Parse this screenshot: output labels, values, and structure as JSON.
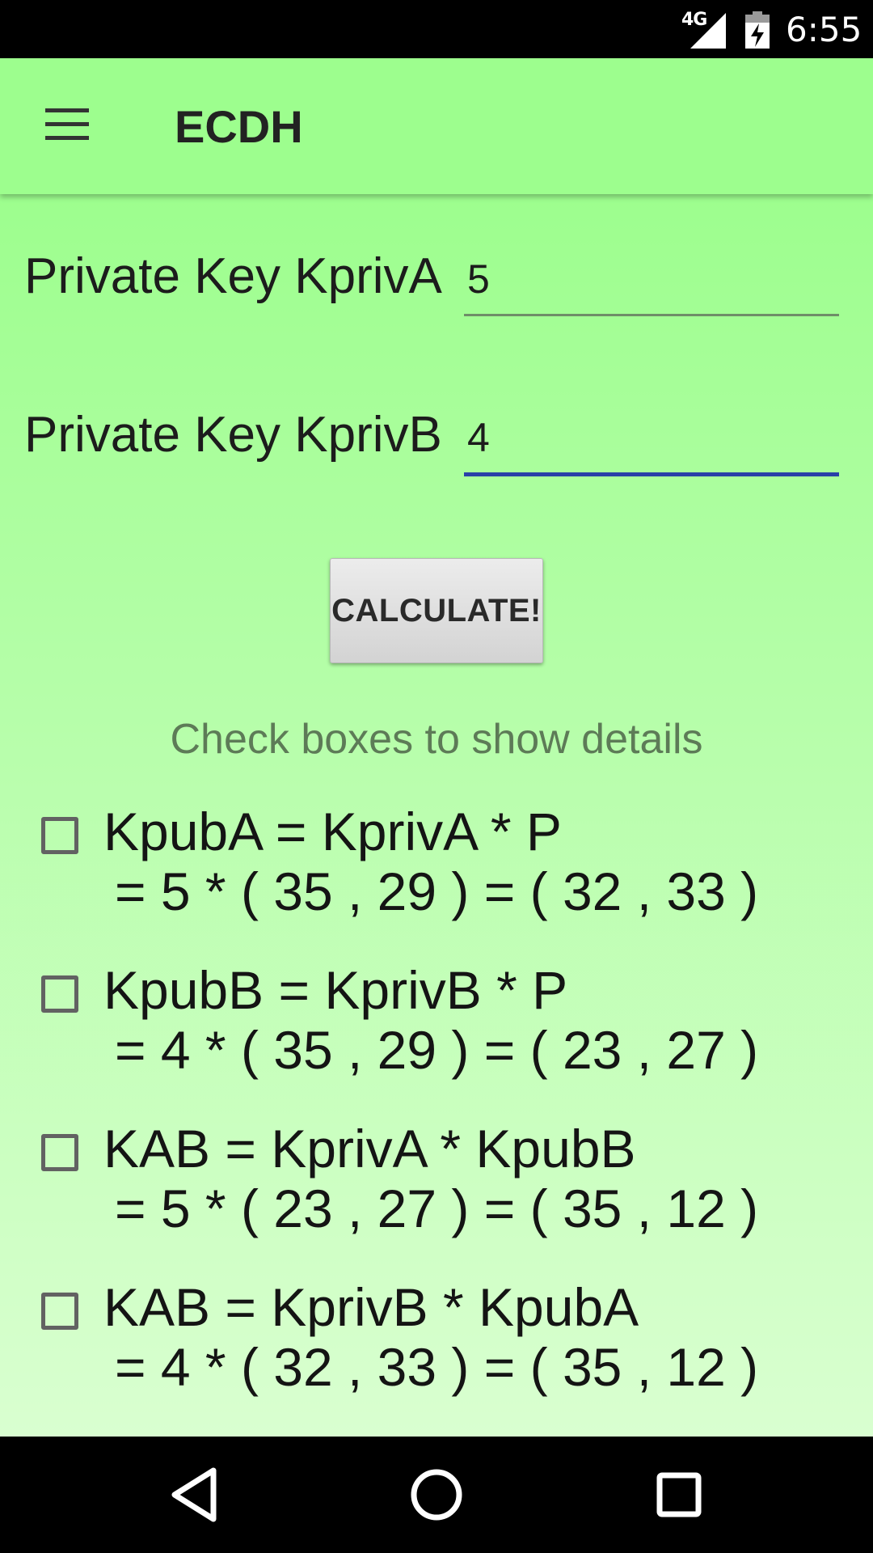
{
  "status_bar": {
    "network": "4G",
    "time": "6:55",
    "icons": [
      "signal-icon",
      "battery-charging-icon"
    ]
  },
  "app_bar": {
    "title": "ECDH",
    "menu_icon": "hamburger-menu-icon"
  },
  "form": {
    "kpriv_a": {
      "label": "Private Key KprivA",
      "value": "5"
    },
    "kpriv_b": {
      "label": "Private Key KprivB",
      "value": "4"
    },
    "calculate_label": "CALCULATE!"
  },
  "hint": "Check boxes to show details",
  "details": [
    {
      "line1": "KpubA = KprivA * P",
      "line2": "= 5 * ( 35 , 29 ) = ( 32 , 33 )",
      "checked": false
    },
    {
      "line1": "KpubB = KprivB * P",
      "line2": "= 4 * ( 35 , 29 ) = ( 23 , 27 )",
      "checked": false
    },
    {
      "line1": "KAB = KprivA * KpubB",
      "line2": "= 5 * ( 23 , 27 ) = ( 35 , 12 )",
      "checked": false
    },
    {
      "line1": "KAB = KprivB * KpubA",
      "line2": "= 4 * ( 32 , 33 ) = ( 35 , 12 )",
      "checked": false
    }
  ],
  "nav_bar": {
    "icons": [
      "back-icon",
      "home-icon",
      "recents-icon"
    ]
  },
  "colors": {
    "app_bar": "#9dfe8e",
    "content_top": "#9dfe8e",
    "content_bottom": "#d9ffd0",
    "input_focus": "#2a3fa8",
    "input_normal": "#6f8d68",
    "hint_text": "#5d7b57"
  }
}
